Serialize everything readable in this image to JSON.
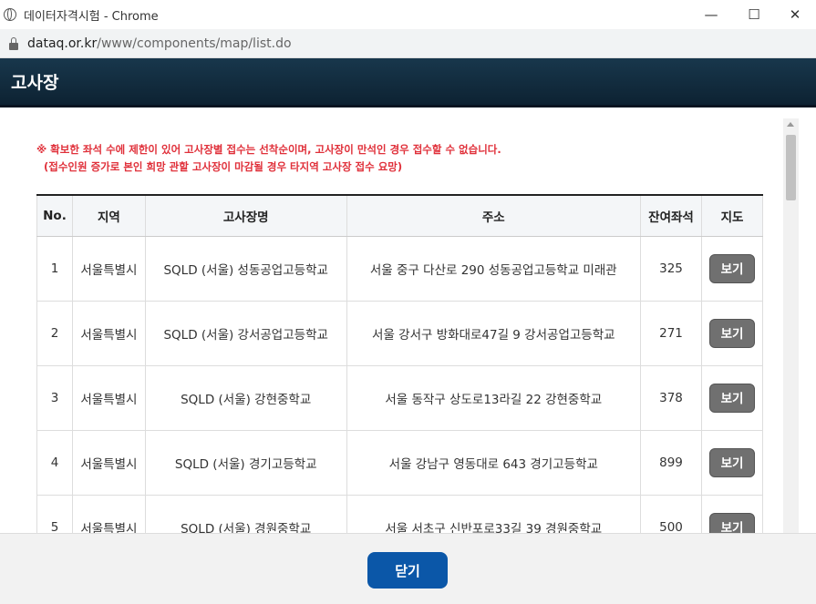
{
  "window": {
    "title": "데이터자격시험 - Chrome",
    "minimize": "—",
    "maximize": "☐",
    "close": "✕"
  },
  "address": {
    "host": "dataq.or.kr",
    "path": "/www/components/map/list.do"
  },
  "header": {
    "title": "고사장"
  },
  "notice": {
    "line1": "※ 확보한 좌석 수에 제한이 있어 고사장별 접수는 선착순이며, 고사장이 만석인 경우 접수할 수 없습니다.",
    "line2": "(접수인원 증가로 본인 희망 관할 고사장이 마감될 경우 타지역 고사장 접수 요망)"
  },
  "table": {
    "headers": [
      "No.",
      "지역",
      "고사장명",
      "주소",
      "잔여좌석",
      "지도"
    ],
    "rows": [
      {
        "no": "1",
        "region": "서울특별시",
        "name": "SQLD (서울) 성동공업고등학교",
        "address": "서울 중구 다산로 290 성동공업고등학교 미래관",
        "seats": "325",
        "map": "보기"
      },
      {
        "no": "2",
        "region": "서울특별시",
        "name": "SQLD (서울) 강서공업고등학교",
        "address": "서울 강서구 방화대로47길 9 강서공업고등학교",
        "seats": "271",
        "map": "보기"
      },
      {
        "no": "3",
        "region": "서울특별시",
        "name": "SQLD (서울) 강현중학교",
        "address": "서울 동작구 상도로13라길 22 강현중학교",
        "seats": "378",
        "map": "보기"
      },
      {
        "no": "4",
        "region": "서울특별시",
        "name": "SQLD (서울) 경기고등학교",
        "address": "서울 강남구 영동대로 643 경기고등학교",
        "seats": "899",
        "map": "보기"
      },
      {
        "no": "5",
        "region": "서울특별시",
        "name": "SQLD (서울) 경원중학교",
        "address": "서울 서초구 신반포로33길 39 경원중학교",
        "seats": "500",
        "map": "보기"
      }
    ]
  },
  "footer": {
    "close_label": "닫기"
  }
}
